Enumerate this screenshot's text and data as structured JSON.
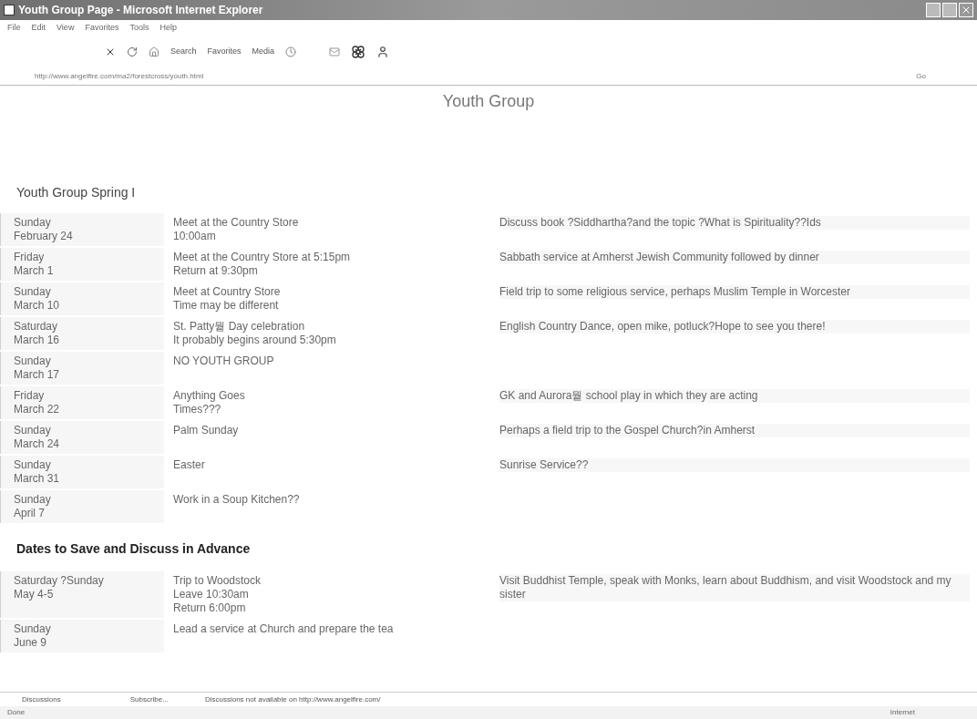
{
  "window": {
    "title": "Youth Group Page - Microsoft Internet Explorer"
  },
  "menu": [
    "File",
    "Edit",
    "View",
    "Favorites",
    "Tools",
    "Help"
  ],
  "toolbar": [
    "Search",
    "Favorites",
    "Media"
  ],
  "address": {
    "url": "http://www.angelfire.com/ma2/forestcross/youth.html",
    "go": "Go"
  },
  "page": {
    "title": "Youth Group",
    "subtitle": "Youth Group Spring I",
    "schedule": [
      {
        "date": [
          "Sunday",
          "February 24"
        ],
        "event": [
          "Meet at the Country Store",
          "10:00am"
        ],
        "note": "Discuss book ?Siddhartha?and the topic ?What is Spirituality??Ids"
      },
      {
        "date": [
          "Friday",
          "March 1"
        ],
        "event": [
          "Meet at the Country Store at 5:15pm",
          "Return at 9:30pm"
        ],
        "note": "Sabbath service at Amherst Jewish Community followed by dinner"
      },
      {
        "date": [
          "Sunday",
          "March 10"
        ],
        "event": [
          "Meet at Country Store",
          "Time may be different"
        ],
        "note": "Field trip to some religious service, perhaps Muslim Temple in Worcester"
      },
      {
        "date": [
          "Saturday",
          "March 16"
        ],
        "event": [
          "St. Patty뭩 Day celebration",
          "It probably begins around 5:30pm"
        ],
        "note": "English Country Dance, open mike, potluck?Hope to see you there!"
      },
      {
        "date": [
          "Sunday",
          "March 17"
        ],
        "event": [
          "NO YOUTH GROUP"
        ]
      },
      {
        "date": [
          "Friday",
          "March 22"
        ],
        "event": [
          "Anything Goes",
          "Times???"
        ],
        "note": "GK and Aurora뭩 school play in which they are acting"
      },
      {
        "date": [
          "Sunday",
          "March 24"
        ],
        "event": [
          "Palm Sunday"
        ],
        "note": "Perhaps a field trip to the Gospel Church?in Amherst"
      },
      {
        "date": [
          "Sunday",
          "March 31"
        ],
        "event": [
          "Easter"
        ],
        "note": "Sunrise Service??"
      },
      {
        "date": [
          "Sunday",
          "April 7"
        ],
        "event": [
          "Work in a Soup Kitchen??"
        ]
      }
    ],
    "advance_heading": "Dates to Save and Discuss in Advance",
    "advance": [
      {
        "date": [
          "Saturday ?Sunday",
          "May 4-5"
        ],
        "event": [
          "Trip to Woodstock",
          "Leave 10:30am",
          "Return 6:00pm"
        ],
        "note": "Visit Buddhist Temple, speak with Monks, learn about Buddhism, and visit Woodstock and my sister"
      },
      {
        "date": [
          "Sunday",
          "June 9"
        ],
        "event": [
          "Lead a service at Church and prepare the tea"
        ]
      }
    ]
  },
  "discussion_bar": {
    "menu": "Discussions",
    "subscribe": "Subscribe...",
    "message": "Discussions not available on http://www.angelfire.com/"
  },
  "status_bar": {
    "text": "Done",
    "zone": "Internet"
  }
}
